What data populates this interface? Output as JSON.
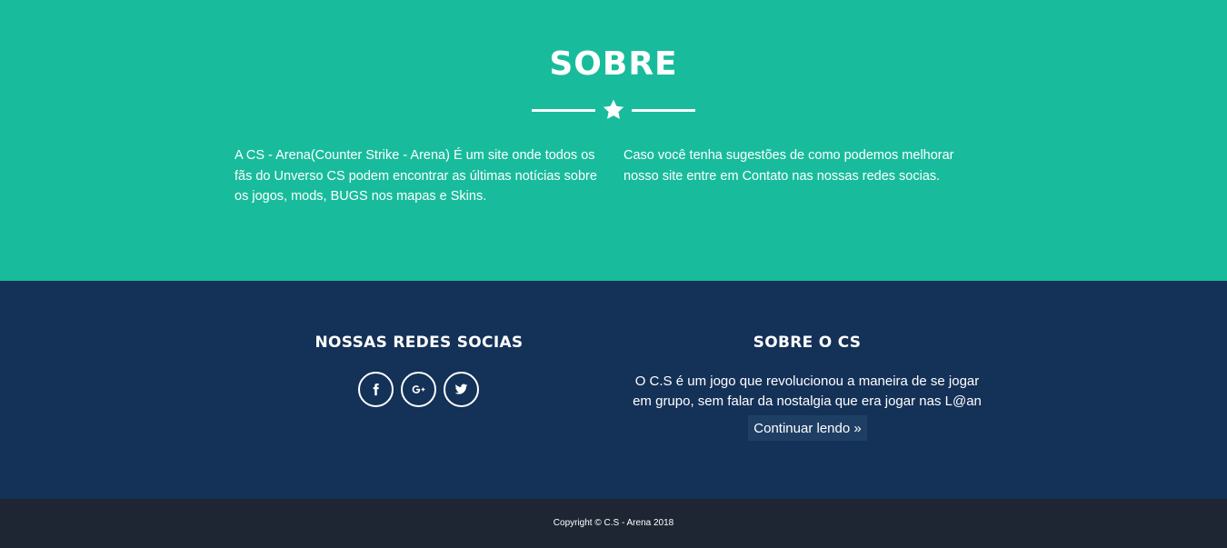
{
  "about": {
    "title": "SOBRE",
    "col1": "A CS - Arena(Counter Strike - Arena) É um site onde todos os fãs do Unverso CS podem encontrar as últimas notícias sobre os jogos, mods, BUGS nos mapas e Skins.",
    "col2": "Caso você tenha sugestões de como podemos melhorar nosso site entre em Contato nas nossas redes socias."
  },
  "footer": {
    "social_heading": "NOSSAS REDES SOCIAS",
    "social_icons": [
      "facebook-icon",
      "google-plus-icon",
      "twitter-icon"
    ],
    "cs_heading": "SOBRE O CS",
    "cs_text": "O C.S é um jogo que revolucionou a maneira de se jogar em grupo, sem falar da nostalgia que era jogar nas L@an house...",
    "continue_label": "Continuar lendo »"
  },
  "copyright": "Copyright © C.S - Arena 2018",
  "colors": {
    "about_bg": "#18bc9c",
    "footer_bg": "#143157",
    "copyright_bg": "#1e2633"
  }
}
